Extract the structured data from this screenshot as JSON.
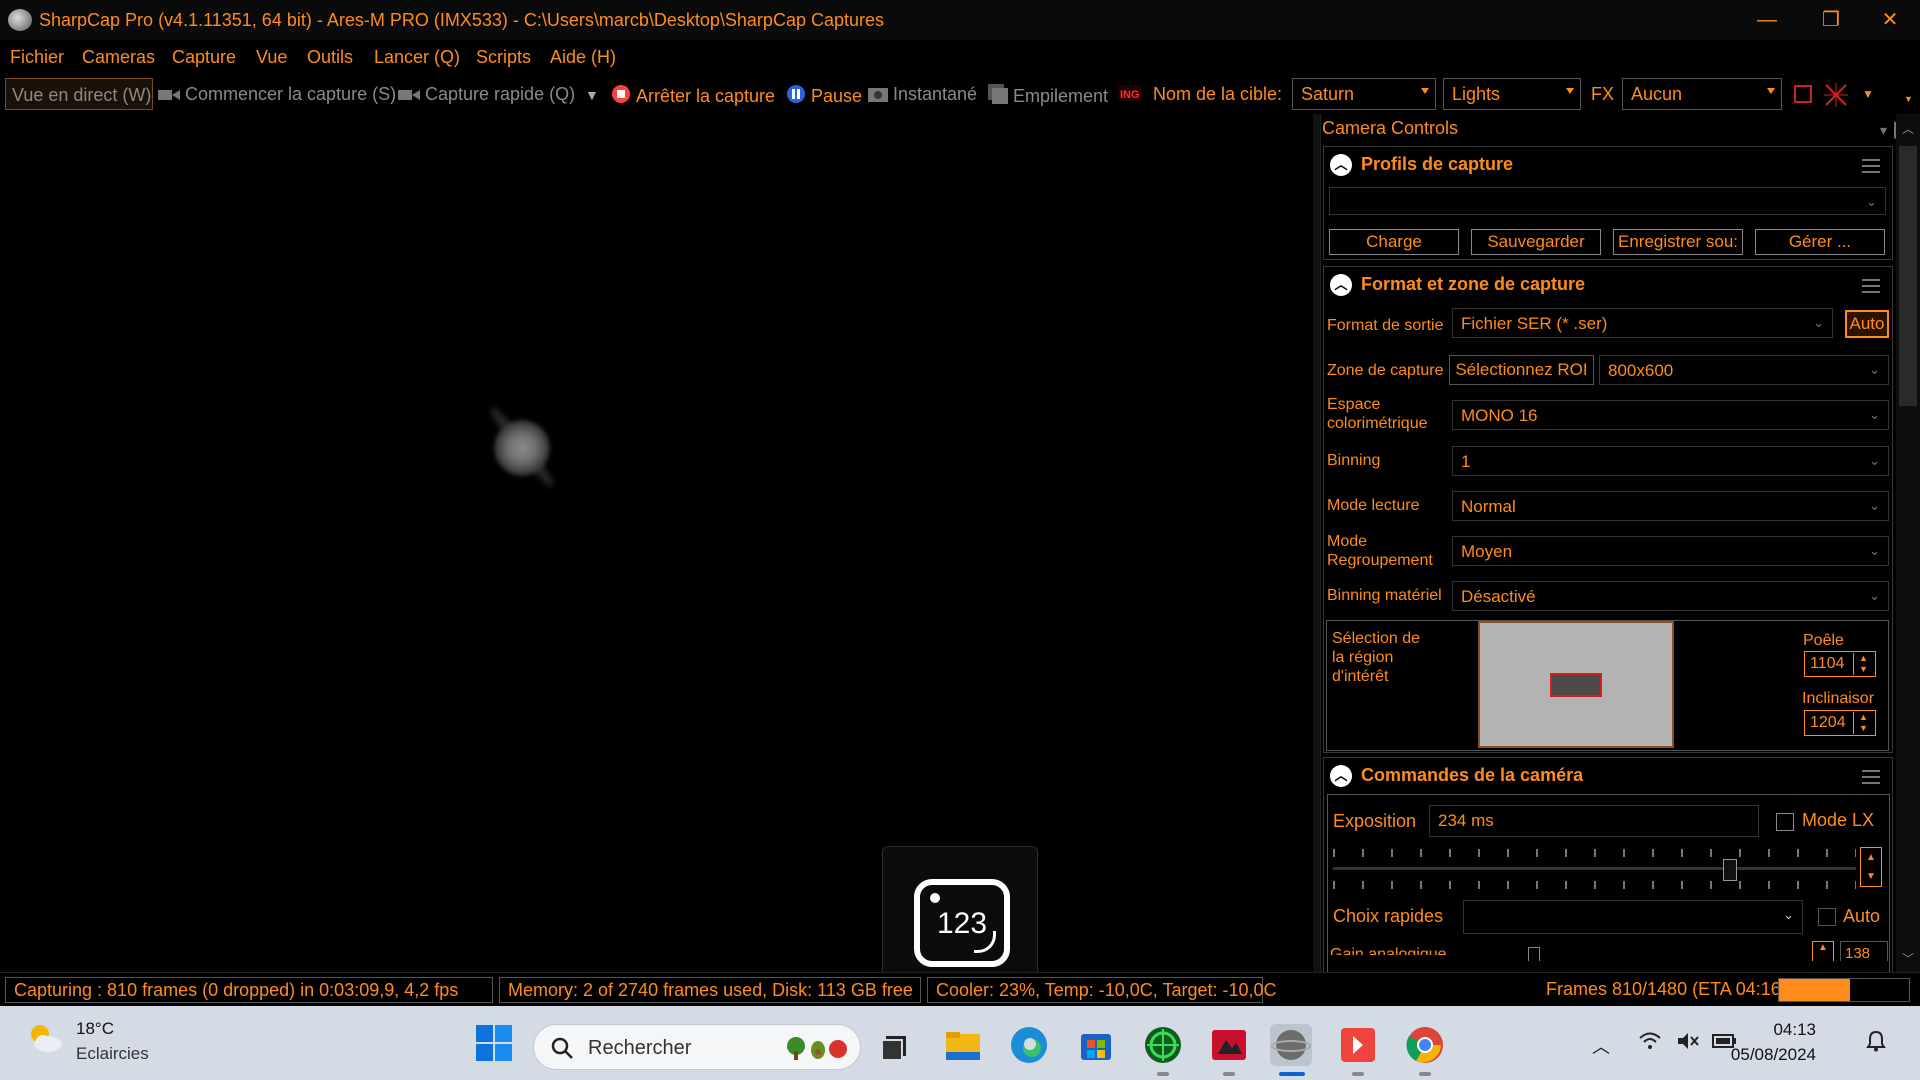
{
  "window": {
    "title": "SharpCap Pro (v4.1.11351, 64 bit) - Ares-M PRO (IMX533) - C:\\Users\\marcb\\Desktop\\SharpCap Captures",
    "minimize": "—",
    "maximize": "❐",
    "close": "✕"
  },
  "menu": [
    "Fichier",
    "Cameras",
    "Capture",
    "Vue",
    "Outils",
    "Lancer (Q)",
    "Scripts",
    "Aide (H)"
  ],
  "toolbar": {
    "live_view": "Vue en direct (W)",
    "start_capture": "Commencer la capture (S)",
    "quick_capture": "Capture rapide (Q)",
    "stop_capture": "Arrêter la capture",
    "pause": "Pause",
    "snapshot": "Instantané",
    "stacking": "Empilement",
    "target_label": "Nom de la cible:",
    "target_value": "Saturn",
    "frame_type": "Lights",
    "fx_label": "FX",
    "fx_value": "Aucun"
  },
  "viewport": {
    "ocr_value": "123"
  },
  "panel": {
    "title": "Camera Controls",
    "profiles": {
      "title": "Profils de capture",
      "selected": "",
      "buttons": [
        "Charge",
        "Sauvegarder",
        "Enregistrer sou:",
        "Gérer ..."
      ]
    },
    "format": {
      "title": "Format et zone de capture",
      "output_format_label": "Format de sortie",
      "output_format_value": "Fichier SER (* .ser)",
      "auto_button": "Auto",
      "capture_area_label": "Zone de capture",
      "roi_button": "Sélectionnez ROI",
      "capture_area_value": "800x600",
      "colorspace_label": "Espace colorimétrique",
      "colorspace_value": "MONO 16",
      "binning_label": "Binning",
      "binning_value": "1",
      "readmode_label": "Mode lecture",
      "readmode_value": "Normal",
      "grouping_label": "Mode Regroupement",
      "grouping_value": "Moyen",
      "hwbinning_label": "Binning matériel",
      "hwbinning_value": "Désactivé",
      "roi_label": "Sélection de la région d'intérêt",
      "pan_label": "Poêle",
      "pan_value": "1104",
      "tilt_label": "Inclinaisor",
      "tilt_value": "1204"
    },
    "camera": {
      "title": "Commandes de la caméra",
      "exposure_label": "Exposition",
      "exposure_value": "234 ms",
      "lx_label": "Mode LX",
      "exposure_slider_fraction": 0.76,
      "quick_label": "Choix rapides",
      "quick_value": "",
      "auto_label": "Auto",
      "gain_label": "Gain analogique",
      "gain_value": "138"
    }
  },
  "status": {
    "capturing": "Capturing : 810 frames (0 dropped) in 0:03:09,9, 4,2 fps",
    "memory": "Memory: 2 of 2740 frames used, Disk: 113 GB free",
    "cooler": "Cooler: 23%, Temp: -10,0C, Target: -10,0C",
    "frames": "Frames 810/1480 (ETA 04:16)",
    "progress_fraction": 0.547
  },
  "taskbar": {
    "weather_temp": "18°C",
    "weather_desc": "Eclaircies",
    "search_placeholder": "Rechercher",
    "time": "04:13",
    "date": "05/08/2024"
  },
  "colors": {
    "accent": "#ff8c1a",
    "background": "#000000",
    "taskbar": "#d4dbe5"
  }
}
